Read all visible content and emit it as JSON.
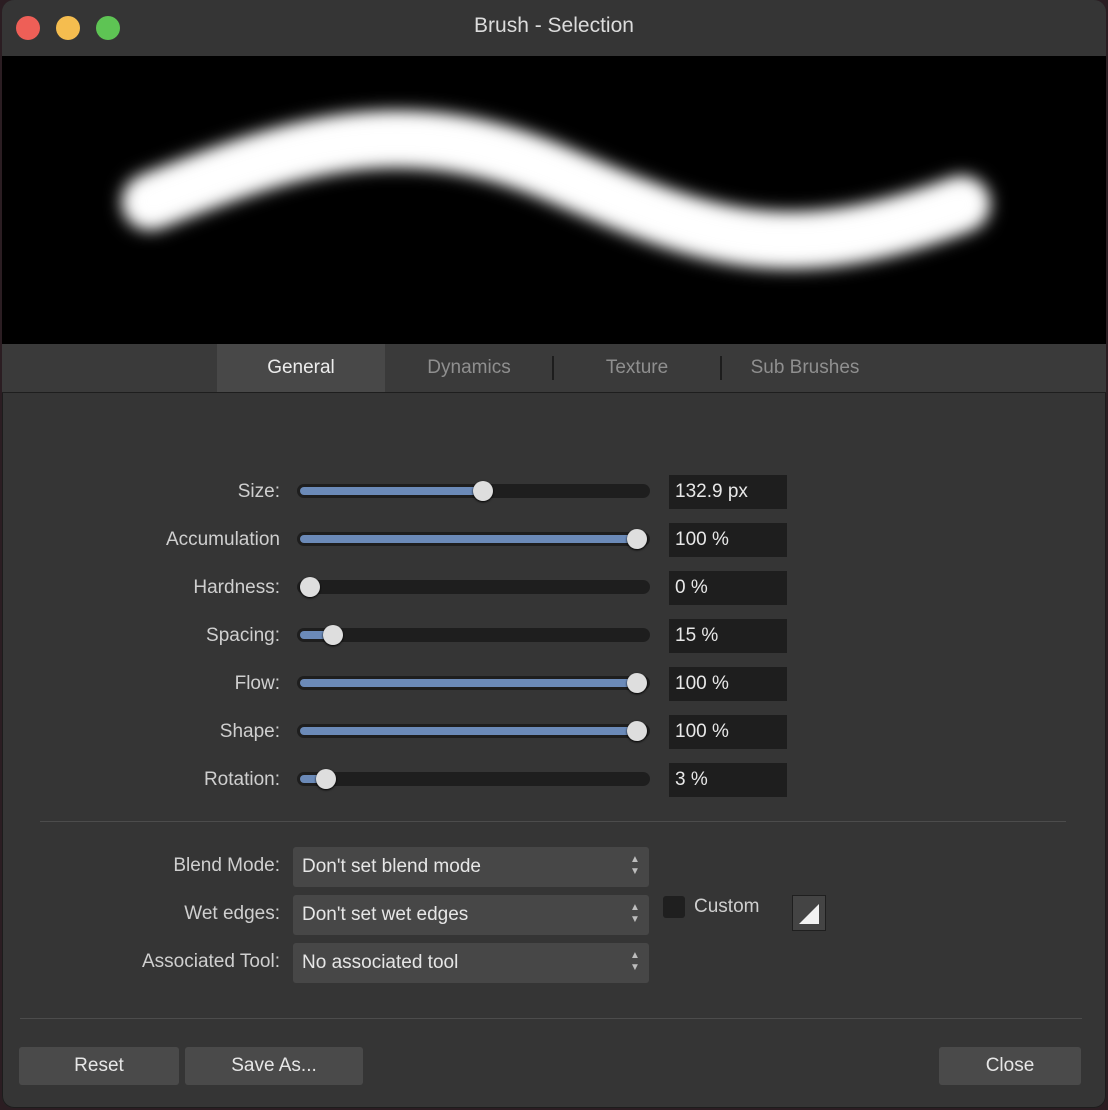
{
  "window": {
    "title": "Brush - Selection"
  },
  "tabs": [
    {
      "label": "General",
      "active": true
    },
    {
      "label": "Dynamics",
      "active": false
    },
    {
      "label": "Texture",
      "active": false
    },
    {
      "label": "Sub Brushes",
      "active": false
    }
  ],
  "sliders": [
    {
      "label": "Size:",
      "value": "132.9 px",
      "level": 0.53
    },
    {
      "label": "Accumulation",
      "value": "100 %",
      "level": 1.0
    },
    {
      "label": "Hardness:",
      "value": "0 %",
      "level": 0.0
    },
    {
      "label": "Spacing:",
      "value": "15 %",
      "level": 0.07
    },
    {
      "label": "Flow:",
      "value": "100 %",
      "level": 1.0
    },
    {
      "label": "Shape:",
      "value": "100 %",
      "level": 1.0
    },
    {
      "label": "Rotation:",
      "value": "3 %",
      "level": 0.05
    }
  ],
  "selects": [
    {
      "label": "Blend Mode:",
      "value": "Don't set blend mode"
    },
    {
      "label": "Wet edges:",
      "value": "Don't set wet edges"
    },
    {
      "label": "Associated Tool:",
      "value": "No associated tool"
    }
  ],
  "custom": {
    "label": "Custom",
    "checked": false
  },
  "buttons": {
    "reset": "Reset",
    "save_as": "Save As...",
    "close": "Close"
  },
  "colors": {
    "accent": "#6b8ab8",
    "window_bg": "#353535",
    "field_bg": "#1e1e1e"
  }
}
